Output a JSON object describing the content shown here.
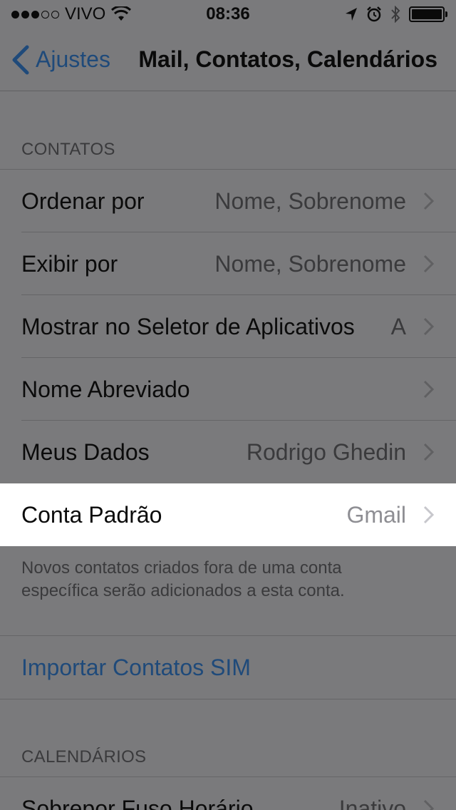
{
  "status_bar": {
    "carrier": "VIVO",
    "time": "08:36"
  },
  "nav": {
    "back_label": "Ajustes",
    "title": "Mail, Contatos, Calendários"
  },
  "sections": {
    "contacts": {
      "header": "CONTATOS",
      "rows": [
        {
          "label": "Ordenar por",
          "value": "Nome, Sobrenome"
        },
        {
          "label": "Exibir por",
          "value": "Nome, Sobrenome"
        },
        {
          "label": "Mostrar no Seletor de Aplicativos",
          "value": "A"
        },
        {
          "label": "Nome Abreviado",
          "value": ""
        },
        {
          "label": "Meus Dados",
          "value": "Rodrigo Ghedin"
        },
        {
          "label": "Conta Padrão",
          "value": "Gmail"
        }
      ],
      "footer": "Novos contatos criados fora de uma conta específica serão adicionados a esta conta."
    },
    "import": {
      "label": "Importar Contatos SIM"
    },
    "calendars": {
      "header": "CALENDÁRIOS",
      "rows": [
        {
          "label": "Sobrepor Fuso Horário",
          "value": "Inativo"
        }
      ]
    }
  },
  "colors": {
    "background": "#7a7a7c",
    "link": "#1f4a7a",
    "highlight": "#ffffff"
  }
}
